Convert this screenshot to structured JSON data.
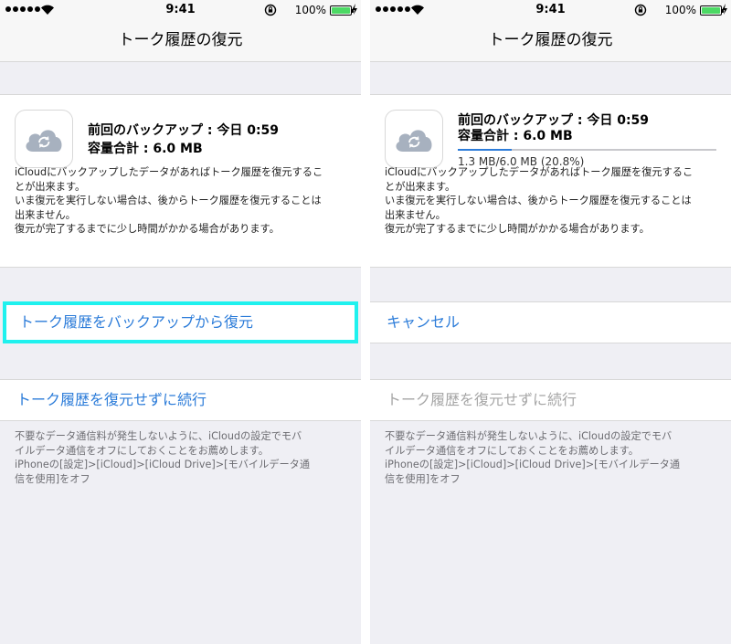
{
  "status_bar": {
    "time": "9:41",
    "battery": "100%"
  },
  "screens": [
    {
      "nav_title": "トーク履歴の復元",
      "backup_info": "前回のバックアップ : 今日 0:59",
      "capacity": "容量合計 : 6.0 MB",
      "description": [
        "iCloudにバックアップしたデータがあればトーク履歴を復元するこ",
        "とが出来ます。",
        "いま復元を実行しない場合は、後からトーク履歴を復元することは",
        "出来ません。",
        "復元が完了するまでに少し時間がかかる場合があります。"
      ],
      "primary_button": "トーク履歴をバックアップから復元",
      "continue_button": "トーク履歴を復元せずに続行",
      "footer": [
        "不要なデータ通信料が発生しないように、iCloudの設定でモバ",
        "イルデータ通信をオフにしておくことをお薦めします。",
        "iPhoneの[設定]>[iCloud]>[iCloud Drive]>[モバイルデータ通",
        "信を使用]をオフ"
      ]
    },
    {
      "nav_title": "トーク履歴の復元",
      "backup_info": "前回のバックアップ : 今日 0:59",
      "capacity": "容量合計 : 6.0 MB",
      "progress_text": "1.3 MB/6.0 MB (20.8%)",
      "progress_fraction": 0.208,
      "description": [
        "iCloudにバックアップしたデータがあればトーク履歴を復元するこ",
        "とが出来ます。",
        "いま復元を実行しない場合は、後からトーク履歴を復元することは",
        "出来ません。",
        "復元が完了するまでに少し時間がかかる場合があります。"
      ],
      "cancel_button": "キャンセル",
      "continue_button": "トーク履歴を復元せずに続行",
      "footer": [
        "不要なデータ通信料が発生しないように、iCloudの設定でモバ",
        "イルデータ通信をオフにしておくことをお薦めします。",
        "iPhoneの[設定]>[iCloud]>[iCloud Drive]>[モバイルデータ通",
        "信を使用]をオフ"
      ]
    }
  ],
  "colors": {
    "accent": "#2c7cd9",
    "highlight": "#1ff1ee",
    "battery": "#4cd964",
    "disabled": "#a6a6a6"
  },
  "icons": [
    "signal-dots-icon",
    "wifi-icon",
    "rotation-lock-icon",
    "battery-icon",
    "charging-bolt-icon",
    "icloud-restore-icon"
  ]
}
